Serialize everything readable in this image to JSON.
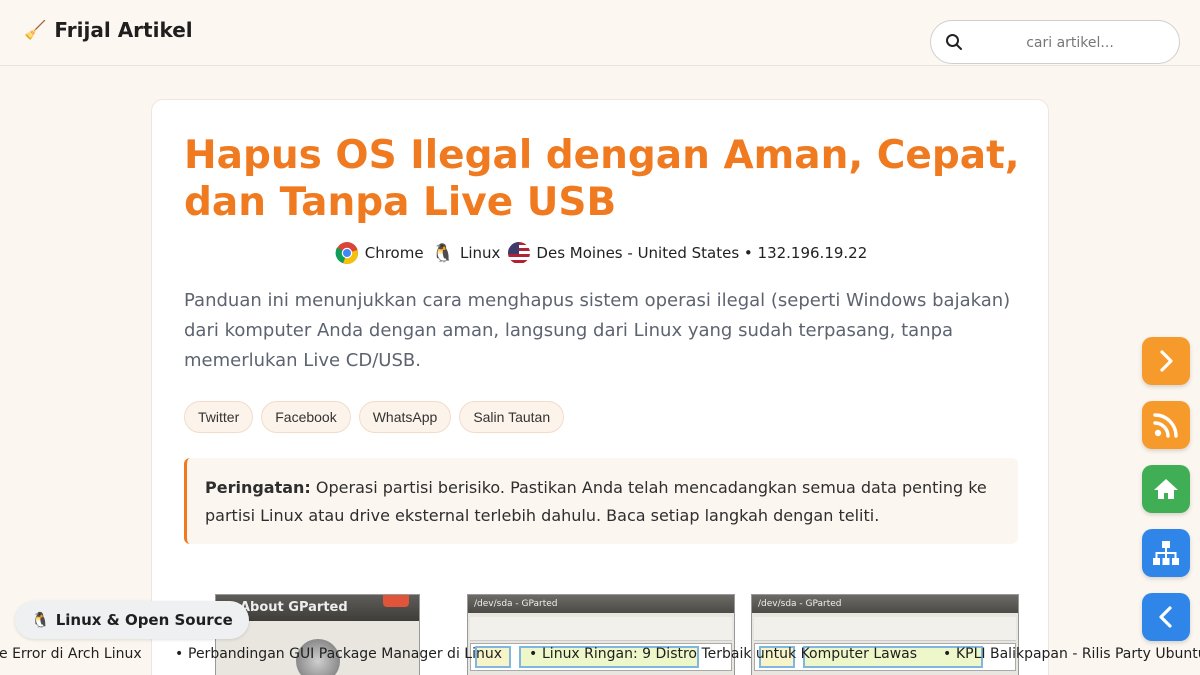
{
  "header": {
    "brand": "Frijal Artikel",
    "search_placeholder": "cari artikel..."
  },
  "article": {
    "title": "Hapus OS Ilegal dengan Aman, Cepat, dan Tanpa Live USB",
    "meta": {
      "browser": "Chrome",
      "os": "Linux",
      "location": "Des Moines - United States • 132.196.19.22"
    },
    "lead": "Panduan ini menunjukkan cara menghapus sistem operasi ilegal (seperti Windows bajakan) dari komputer Anda dengan aman, langsung dari Linux yang sudah terpasang, tanpa memerlukan Live CD/USB.",
    "share_buttons": [
      "Twitter",
      "Facebook",
      "WhatsApp",
      "Salin Tautan"
    ],
    "warning_label": "Peringatan:",
    "warning_text": " Operasi partisi berisiko. Pastikan Anda telah mencadangkan semua data penting ke partisi Linux atau drive eksternal terlebih dahulu. Baca setiap langkah dengan teliti.",
    "screenshots": {
      "about_title": "About GParted",
      "gparted_title": "/dev/sda - GParted"
    }
  },
  "side_buttons": [
    "next-arrow-icon",
    "rss-icon",
    "home-icon",
    "sitemap-icon",
    "back-arrow-icon"
  ],
  "category_pill": "Linux & Open Source",
  "ticker": [
    "e Error di Arch Linux",
    "Perbandingan GUI Package Manager di Linux",
    "Linux Ringan: 9 Distro Terbaik untuk Komputer Lawas",
    "KPLI Balikpapan - Rilis Party Ubuntu"
  ],
  "colors": {
    "accent": "#f07a1f",
    "background": "#fcf6f0",
    "fab_orange": "#f79a2c",
    "fab_green": "#3fae55",
    "fab_blue": "#2f86e8"
  }
}
